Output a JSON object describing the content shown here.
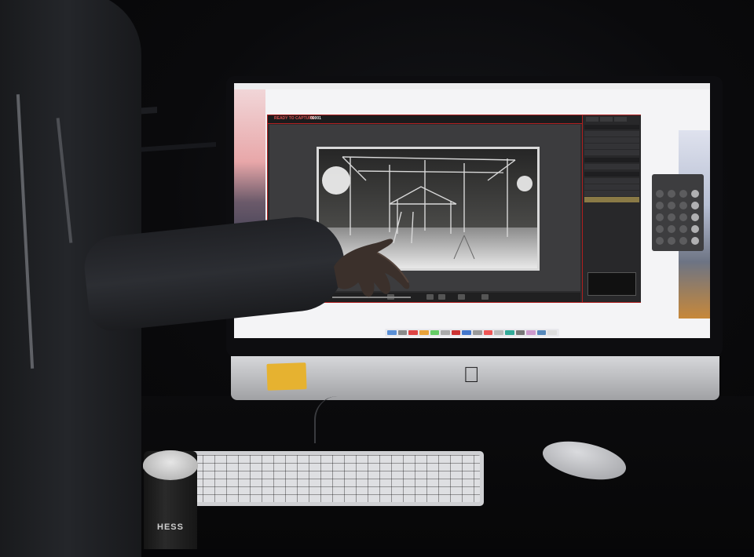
{
  "scene": {
    "description_colors": {
      "room": "#060608",
      "imac_chin": "#c2c3c6",
      "sticky_note": "#e6b230",
      "app_accent_red": "#b02020",
      "layer_highlight": "#8a7a46"
    },
    "icons": [
      "apple-logo-icon",
      "play-icon",
      "stop-icon",
      "camera-icon"
    ]
  },
  "app": {
    "capture_status": "READY TO CAPTURE:",
    "frame_counter": "00001"
  },
  "coffee_cup": {
    "label": "HESS"
  }
}
